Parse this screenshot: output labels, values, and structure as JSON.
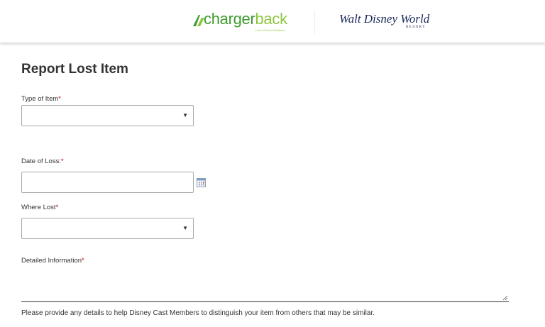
{
  "header": {
    "chargerback_logo": {
      "word_dark": "charger",
      "word_light": "back",
      "tagline": "Lost & Found Solutions"
    },
    "wdw_logo": {
      "name": "Walt Disney World",
      "sub": "RESORT"
    }
  },
  "page": {
    "title": "Report Lost Item"
  },
  "form": {
    "type_of_item": {
      "label": "Type of Item",
      "required_mark": "*",
      "selected": ""
    },
    "date_of_loss": {
      "label": "Date of Loss:",
      "required_mark": "*",
      "value": ""
    },
    "where_lost": {
      "label": "Where Lost",
      "required_mark": "*",
      "selected": ""
    },
    "detailed_information": {
      "label": "Detailed Information",
      "required_mark": "*",
      "value": "",
      "helper": "Please provide any details to help Disney Cast Members to distinguish your item from others that may be similar."
    }
  },
  "icons": {
    "select_caret": "▼",
    "calendar": "calendar-icon"
  },
  "colors": {
    "required": "#cc0000",
    "chargerback_dark": "#3f9b2f",
    "chargerback_light": "#8cc63f",
    "disney_navy": "#1a2a5a"
  }
}
